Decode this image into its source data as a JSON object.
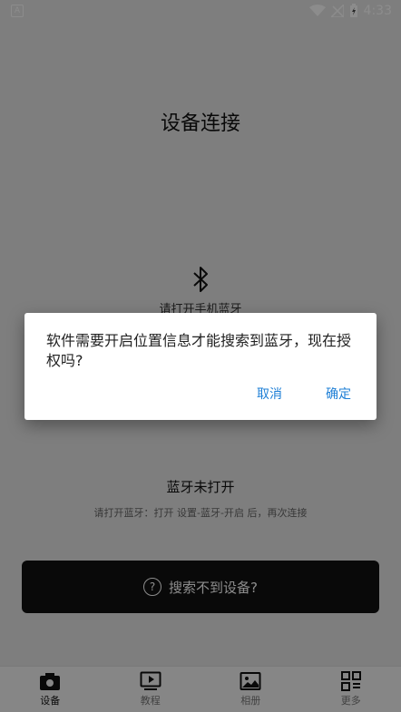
{
  "status_bar": {
    "time": "4:33",
    "app_badge": "A"
  },
  "main": {
    "title": "设备连接",
    "bt_hint": "请打开手机蓝牙",
    "bt_status": "蓝牙未打开",
    "bt_instruction": "请打开蓝牙：打开 设置-蓝牙-开启 后，再次连接",
    "search_button": "搜索不到设备?"
  },
  "dialog": {
    "message": "软件需要开启位置信息才能搜索到蓝牙，现在授权吗?",
    "cancel": "取消",
    "confirm": "确定"
  },
  "bottom_nav": {
    "items": [
      {
        "label": "设备",
        "icon": "camera-icon"
      },
      {
        "label": "教程",
        "icon": "video-icon"
      },
      {
        "label": "相册",
        "icon": "image-icon"
      },
      {
        "label": "更多",
        "icon": "grid-icon"
      }
    ],
    "active_index": 0
  },
  "colors": {
    "accent": "#1e7fd6",
    "button_bg": "#111111"
  }
}
